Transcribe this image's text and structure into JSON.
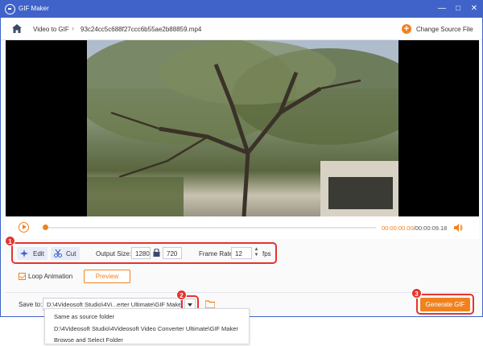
{
  "window": {
    "title": "GIF Maker"
  },
  "breadcrumb": {
    "section": "Video to GIF",
    "file": "93c24cc5c688f27ccc6b55ae2b88859.mp4"
  },
  "change_source_label": "Change Source File",
  "player": {
    "current_time": "00:00:00.00",
    "separator": "/",
    "total_time": "00:00:09.18",
    "progress": 0.0
  },
  "edit_row": {
    "edit_label": "Edit",
    "cut_label": "Cut",
    "output_size_label": "Output Size:",
    "width": "1280",
    "height": "720",
    "frame_rate_label": "Frame Rate:",
    "frame_rate": "12",
    "fps_label": "fps"
  },
  "loop": {
    "label": "Loop Animation",
    "checked": true
  },
  "preview_label": "Preview",
  "save": {
    "label": "Save to:",
    "path": "D:\\4Videosoft Studio\\4Vi...erter Ultimate\\GIF Maker",
    "options": [
      "Same as source folder",
      "D:\\4Videosoft Studio\\4Videosoft Video Converter Ultimate\\GIF Maker",
      "Browse and Select Folder"
    ]
  },
  "generate_label": "Generate GIF",
  "callouts": [
    "1",
    "2",
    "3"
  ],
  "colors": {
    "accent": "#f0821e",
    "titlebar": "#3f63c8",
    "callout": "#e4342e"
  }
}
